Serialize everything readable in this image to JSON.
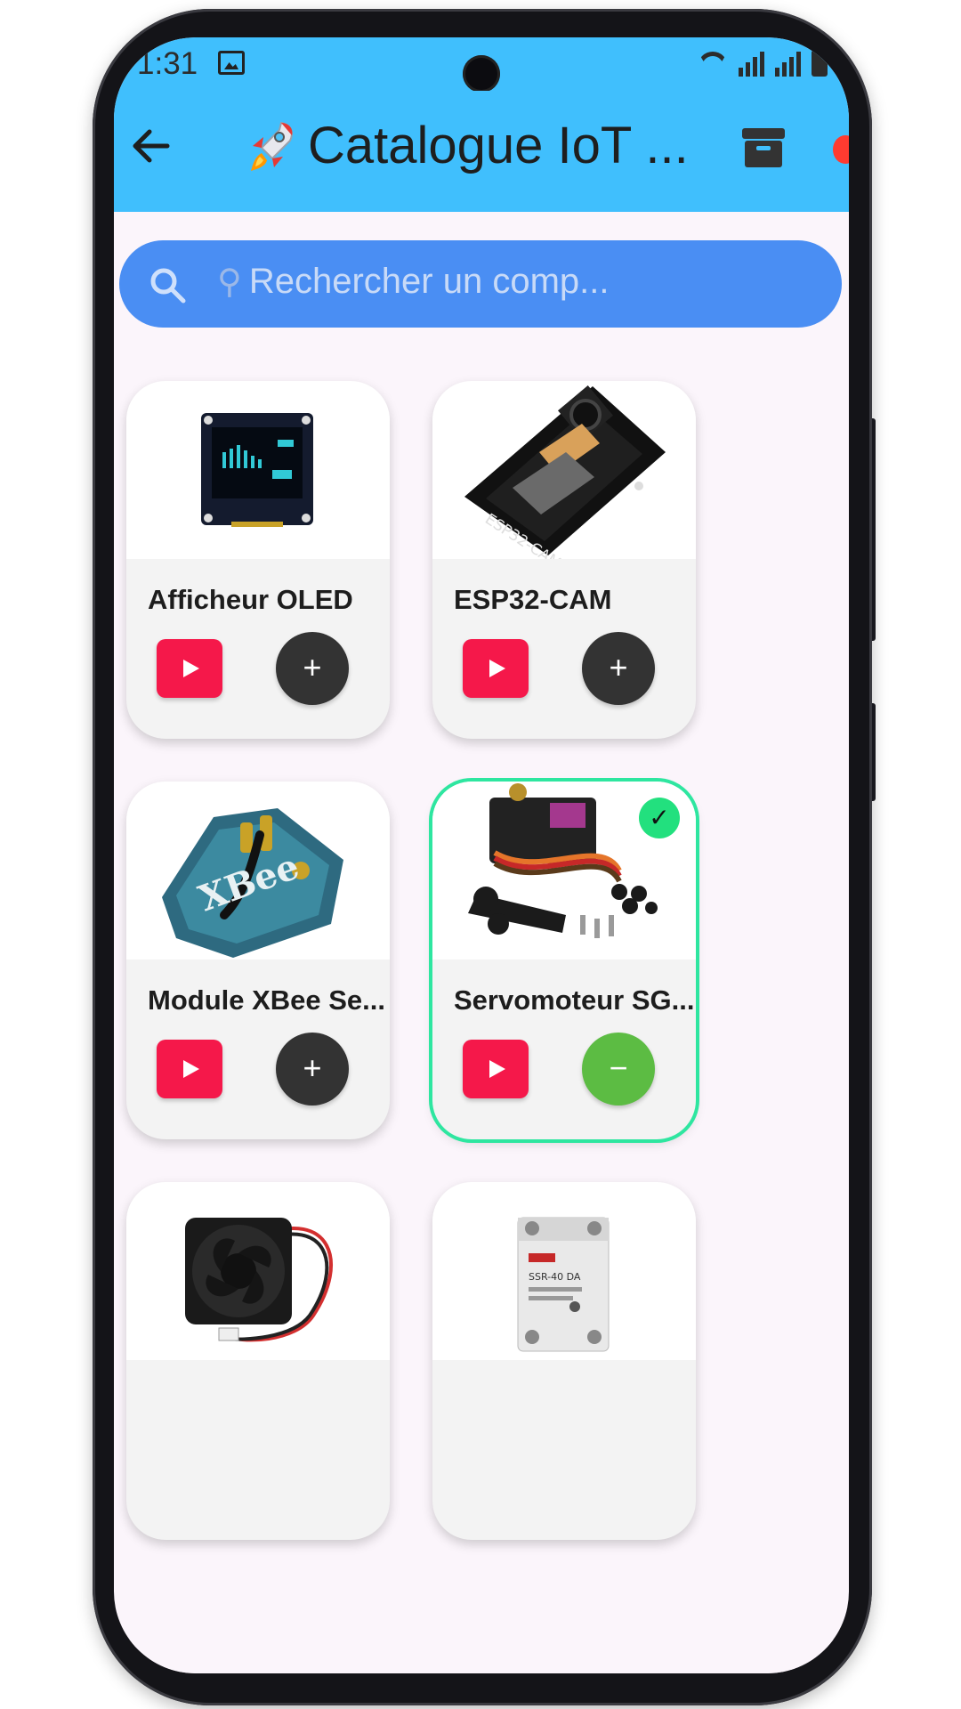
{
  "status_bar": {
    "time": "1:31"
  },
  "app_bar": {
    "title": "Catalogue IoT ..."
  },
  "search": {
    "placeholder": "Rechercher un comp..."
  },
  "products": [
    {
      "name": "Afficheur OLED",
      "selected": false,
      "action": "+"
    },
    {
      "name": "ESP32-CAM",
      "selected": false,
      "action": "+"
    },
    {
      "name": "Module XBee Se...",
      "selected": false,
      "action": "+"
    },
    {
      "name": "Servomoteur SG...",
      "selected": true,
      "action": "−"
    },
    {
      "name": "",
      "selected": false,
      "action": ""
    },
    {
      "name": "",
      "selected": false,
      "action": ""
    }
  ],
  "image_text": {
    "esp32_label": "ESP32-CAM",
    "xbee_label": "XBee",
    "relay_label": "SSR-40 DA"
  },
  "colors": {
    "app_bar": "#40bffd",
    "search_bar": "#4a8ef3",
    "video_button": "#f5184a",
    "add_button": "#333333",
    "remove_button": "#5cbc43",
    "selected_border": "#2ee6a0",
    "check_badge": "#22e07e"
  }
}
